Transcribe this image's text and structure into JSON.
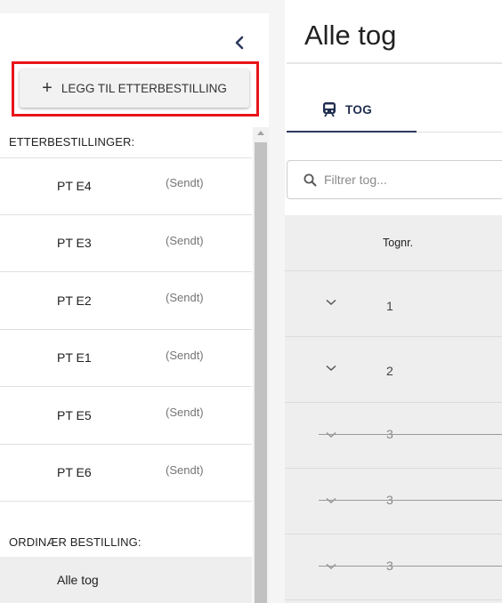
{
  "sidebar": {
    "add_button_label": "LEGG TIL ETTERBESTILLING",
    "section_etter": "ETTERBESTILLINGER:",
    "items": [
      {
        "name": "PT E4",
        "status": "(Sendt)"
      },
      {
        "name": "PT E3",
        "status": "(Sendt)"
      },
      {
        "name": "PT E2",
        "status": "(Sendt)"
      },
      {
        "name": "PT E1",
        "status": "(Sendt)"
      },
      {
        "name": "PT E5",
        "status": "(Sendt)"
      },
      {
        "name": "PT E6",
        "status": "(Sendt)"
      }
    ],
    "section_ordinaer": "ORDINÆR BESTILLING:",
    "ordinaer_item": "Alle tog"
  },
  "main": {
    "title": "Alle tog",
    "tab_label": "TOG",
    "filter_placeholder": "Filtrer tog...",
    "table": {
      "header": "Tognr.",
      "rows": [
        {
          "number": "1",
          "cancelled": false
        },
        {
          "number": "2",
          "cancelled": false
        },
        {
          "number": "3",
          "cancelled": true
        },
        {
          "number": "3",
          "cancelled": true
        },
        {
          "number": "3",
          "cancelled": true
        }
      ]
    }
  },
  "colors": {
    "accent": "#2d3a5e",
    "highlight": "#e8141a"
  },
  "icons": [
    "chevron-left-icon",
    "plus-icon",
    "train-icon",
    "search-icon",
    "chevron-down-icon"
  ]
}
